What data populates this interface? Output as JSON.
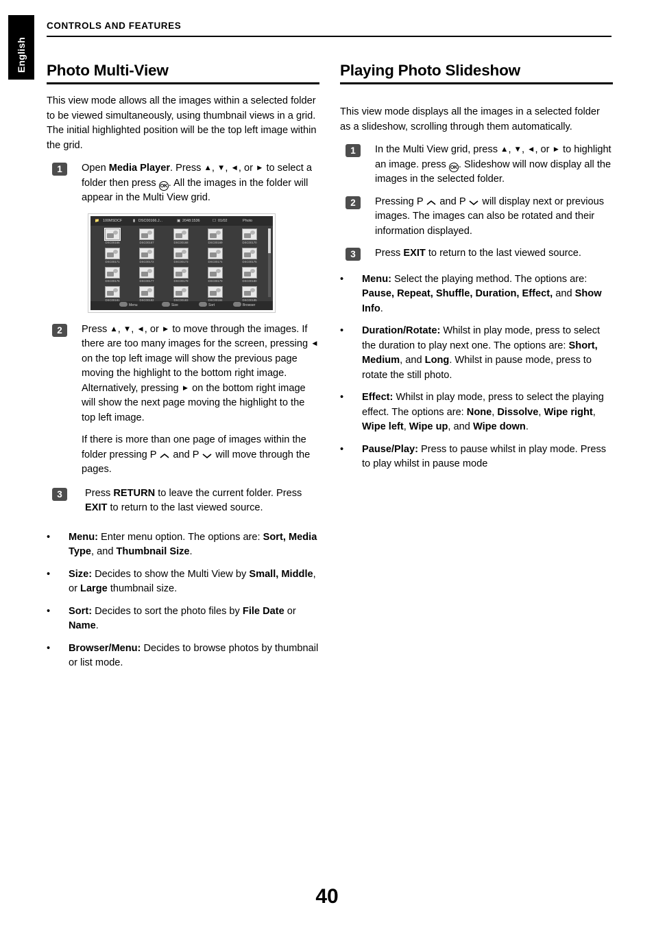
{
  "lang_tab": "English",
  "header": {
    "title": "CONTROLS AND FEATURES"
  },
  "page_number": "40",
  "left": {
    "title": "Photo Multi-View",
    "intro": "This view mode allows all the images within a selected folder to be viewed simultaneously, using thumbnail views in a grid. The initial highlighted position will be the top left image within the grid.",
    "steps": [
      {
        "num": "1",
        "html": "Open <b>Media Player</b>. Press ▲, ▼, ◄, or ► to select a folder then press OK. All the images in the folder will appear in the Multi View grid."
      },
      {
        "num": "2",
        "html": "Press ▲, ▼, ◄, or ► to move through the images. If there are too many images for the screen, pressing ◄ on the top left image will show the previous page moving the highlight to the bottom right image. Alternatively, pressing ► on the bottom right image will show the next page moving the highlight to the top left image."
      },
      {
        "num": "3",
        "html": "Press <b>RETURN</b> to leave the current folder. Press <b>EXIT</b> to return to the last viewed source."
      }
    ],
    "para_pages": "If there is more than one page of images within the folder pressing P ⌃ and P ⌄ will move through the pages.",
    "bullets": [
      "<b>Menu:</b> Enter menu option. The options are: <b>Sort, Media Type</b>, and <b>Thumbnail Size</b>.",
      "<b>Size:</b> Decides to show the Multi View by <b>Small, Middle</b>, or <b>Large</b> thumbnail size.",
      "<b>Sort:</b> Decides to sort the photo files by <b>File Date</b> or <b>Name</b>.",
      "<b>Browser/Menu:</b> Decides to browse photos by thumbnail or list mode."
    ],
    "figure": {
      "status_folder": "100MSDCF",
      "status_file": "DSC00166.J...",
      "status_resolution": "2048:1536",
      "status_count": "01/02",
      "status_mode": "Photo",
      "thumb_captions": [
        "DSC00166",
        "DSC00167",
        "DSC00168",
        "DSC00169",
        "DSC00170",
        "DSC00171",
        "DSC00172",
        "DSC00173",
        "DSC00174",
        "DSC00175",
        "DSC00176",
        "DSC00177",
        "DSC00178",
        "DSC00179",
        "DSC00180",
        "DSC00181",
        "DSC00182",
        "DSC00183",
        "DSC00184",
        "DSC00185"
      ],
      "footer_keys": [
        "Menu",
        "Size",
        "Sort",
        "Browser"
      ]
    }
  },
  "right": {
    "title": "Playing Photo Slideshow",
    "intro": "This view mode displays all the images in a selected folder as a slideshow, scrolling through them automatically.",
    "steps": [
      {
        "num": "1",
        "html": "In the Multi View grid, press ▲, ▼, ◄, or ► to highlight an image. Press OK. Slideshow will now display all the images in the selected folder."
      },
      {
        "num": "2",
        "html": "Pressing P ⌃ and P ⌄ will display next or previous images. The images can also be rotated and their information displayed."
      },
      {
        "num": "3",
        "html": "Press <b>EXIT</b> to return to the last viewed source."
      }
    ],
    "bullets": [
      "<b>Menu:</b> Select the playing method. The options are: <b>Pause, Repeat, Shuffle, Duration, Effect,</b> and <b>Show Info</b>.",
      "<b>Duration/Rotate:</b> Whilst in play mode, press to select the duration to play next one. The options are: <b>Short, Medium</b>, and <b>Long</b>. Whilst in pause mode, press to rotate the still photo.",
      "<b>Effect:</b> Whilst in play mode, press to select the playing effect. The options are: <b>None</b>, <b>Dissolve</b>, <b>Wipe right</b>, <b>Wipe left</b>, <b>Wipe up</b>, and <b>Wipe down</b>.",
      "<b>Pause/Play:</b> Press to pause whilst in play mode. Press to play whilst in pause mode"
    ]
  }
}
